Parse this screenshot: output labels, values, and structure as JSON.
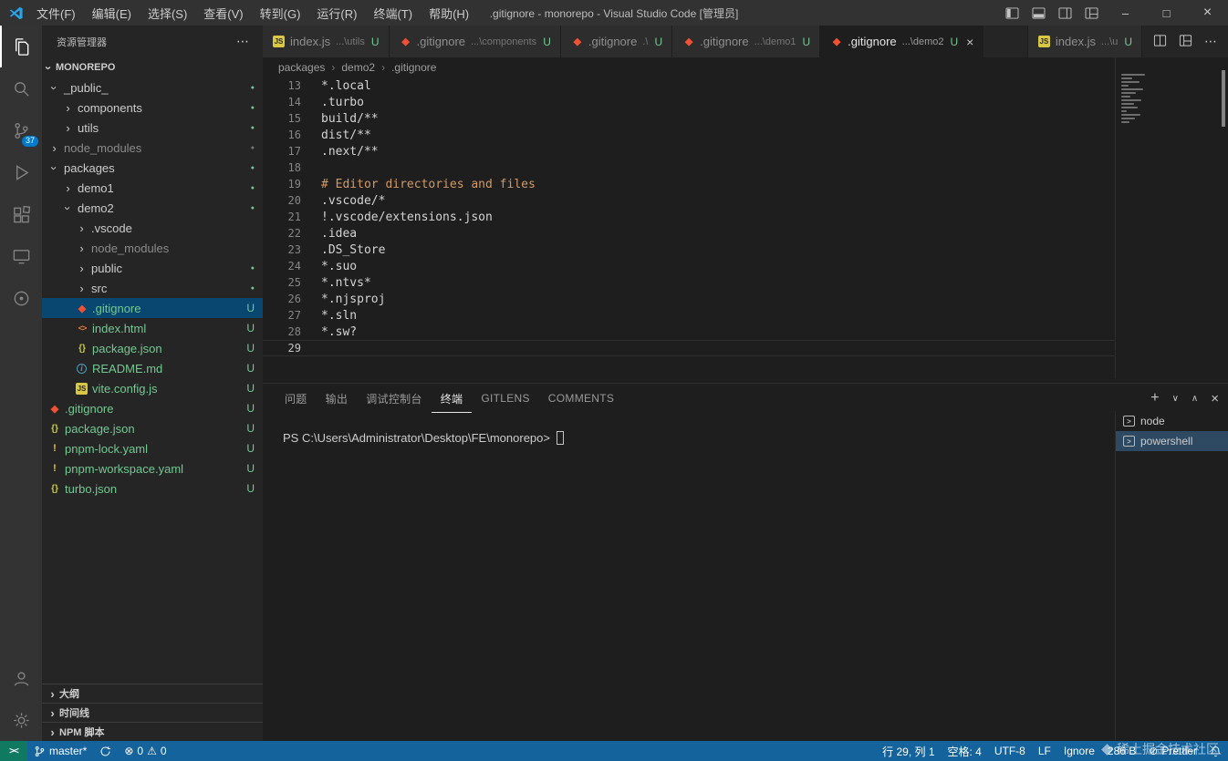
{
  "colors": {
    "accent": "#007acc",
    "status_blue": "#15639d",
    "remote_teal": "#0f7962",
    "untracked": "#73c991",
    "comment": "#d19a66",
    "git_red": "#f05133"
  },
  "icons": {
    "chevron": "›",
    "ellipsis": "⋯",
    "modified_dot": "●",
    "close": "×",
    "minimize": "–",
    "maximize": "□",
    "plus": "+",
    "chevron_down": "∨",
    "chevron_up": "∧",
    "remote": "><",
    "error": "⊗",
    "warning": "⚠",
    "prettier": "⊘",
    "terminal_box": ">",
    "js": "JS",
    "json_braces": "{}",
    "html_tags": "<>",
    "yaml_bang": "!",
    "info_i": "i",
    "git_diamond": "◆"
  },
  "title_bar": {
    "menus": [
      "文件(F)",
      "编辑(E)",
      "选择(S)",
      "查看(V)",
      "转到(G)",
      "运行(R)",
      "终端(T)",
      "帮助(H)"
    ],
    "title": ".gitignore - monorepo - Visual Studio Code [管理员]"
  },
  "activity_bar": {
    "scm_badge": "37"
  },
  "sidebar": {
    "header": "资源管理器",
    "root_label": "MONOREPO",
    "tree": [
      {
        "label": "_public_",
        "type": "folder",
        "level": 0,
        "expanded": true,
        "dot": true
      },
      {
        "label": "components",
        "type": "folder",
        "level": 1,
        "dot": true
      },
      {
        "label": "utils",
        "type": "folder",
        "level": 1,
        "dot": true
      },
      {
        "label": "node_modules",
        "type": "folder",
        "level": 0,
        "dim": true,
        "dot": true
      },
      {
        "label": "packages",
        "type": "folder",
        "level": 0,
        "expanded": true,
        "dot": true
      },
      {
        "label": "demo1",
        "type": "folder",
        "level": 1,
        "dot": true
      },
      {
        "label": "demo2",
        "type": "folder",
        "level": 1,
        "expanded": true,
        "dot": true
      },
      {
        "label": ".vscode",
        "type": "folder",
        "level": 2
      },
      {
        "label": "node_modules",
        "type": "folder",
        "level": 2,
        "dim": true
      },
      {
        "label": "public",
        "type": "folder",
        "level": 2,
        "dot": true
      },
      {
        "label": "src",
        "type": "folder",
        "level": 2,
        "dot": true
      },
      {
        "label": ".gitignore",
        "type": "file",
        "icon": "git",
        "level": 2,
        "badge": "U",
        "selected": true
      },
      {
        "label": "index.html",
        "type": "file",
        "icon": "html",
        "level": 2,
        "badge": "U"
      },
      {
        "label": "package.json",
        "type": "file",
        "icon": "json",
        "level": 2,
        "badge": "U"
      },
      {
        "label": "README.md",
        "type": "file",
        "icon": "info",
        "level": 2,
        "badge": "U"
      },
      {
        "label": "vite.config.js",
        "type": "file",
        "icon": "js",
        "level": 2,
        "badge": "U"
      },
      {
        "label": ".gitignore",
        "type": "file",
        "icon": "git",
        "level": 0,
        "badge": "U"
      },
      {
        "label": "package.json",
        "type": "file",
        "icon": "json",
        "level": 0,
        "badge": "U"
      },
      {
        "label": "pnpm-lock.yaml",
        "type": "file",
        "icon": "excl",
        "level": 0,
        "badge": "U"
      },
      {
        "label": "pnpm-workspace.yaml",
        "type": "file",
        "icon": "excl",
        "level": 0,
        "badge": "U"
      },
      {
        "label": "turbo.json",
        "type": "file",
        "icon": "json",
        "level": 0,
        "badge": "U"
      }
    ],
    "sections": [
      "大纲",
      "时间线",
      "NPM 脚本"
    ]
  },
  "editor_tabs": {
    "group1": [
      {
        "icon": "js",
        "label": "index.js",
        "detail": "...\\utils",
        "badge": "U"
      },
      {
        "icon": "git",
        "label": ".gitignore",
        "detail": "...\\components",
        "badge": "U"
      },
      {
        "icon": "git",
        "label": ".gitignore",
        "detail": ".\\",
        "badge": "U"
      },
      {
        "icon": "git",
        "label": ".gitignore",
        "detail": "...\\demo1",
        "badge": "U"
      },
      {
        "icon": "git",
        "label": ".gitignore",
        "detail": "...\\demo2",
        "badge": "U",
        "active": true
      }
    ],
    "group2": [
      {
        "icon": "js",
        "label": "index.js",
        "detail": "...\\u",
        "badge": "U"
      }
    ]
  },
  "breadcrumb": [
    "packages",
    "demo2",
    ".gitignore"
  ],
  "editor": {
    "lines": [
      {
        "n": 13,
        "text": "*.local"
      },
      {
        "n": 14,
        "text": ".turbo"
      },
      {
        "n": 15,
        "text": "build/**"
      },
      {
        "n": 16,
        "text": "dist/**"
      },
      {
        "n": 17,
        "text": ".next/**"
      },
      {
        "n": 18,
        "text": ""
      },
      {
        "n": 19,
        "text": "# Editor directories and files",
        "comment": true
      },
      {
        "n": 20,
        "text": ".vscode/*"
      },
      {
        "n": 21,
        "text": "!.vscode/extensions.json"
      },
      {
        "n": 22,
        "text": ".idea"
      },
      {
        "n": 23,
        "text": ".DS_Store"
      },
      {
        "n": 24,
        "text": "*.suo"
      },
      {
        "n": 25,
        "text": "*.ntvs*"
      },
      {
        "n": 26,
        "text": "*.njsproj"
      },
      {
        "n": 27,
        "text": "*.sln"
      },
      {
        "n": 28,
        "text": "*.sw?"
      },
      {
        "n": 29,
        "text": "",
        "current": true
      }
    ]
  },
  "panel": {
    "tabs": [
      {
        "label": "问题"
      },
      {
        "label": "输出"
      },
      {
        "label": "调试控制台"
      },
      {
        "label": "终端",
        "active": true
      },
      {
        "label": "GITLENS"
      },
      {
        "label": "COMMENTS"
      }
    ],
    "terminal_prompt": "PS C:\\Users\\Administrator\\Desktop\\FE\\monorepo>",
    "terminal_list": [
      {
        "label": "node"
      },
      {
        "label": "powershell",
        "selected": true
      }
    ]
  },
  "status_bar": {
    "branch": "master*",
    "errors": "0",
    "warnings": "0",
    "right_items": [
      "行 29, 列 1",
      "空格: 4",
      "UTF-8",
      "LF",
      "Ignore",
      "286 B",
      "Prettier"
    ]
  },
  "watermark": "稀土掘金技术社区"
}
